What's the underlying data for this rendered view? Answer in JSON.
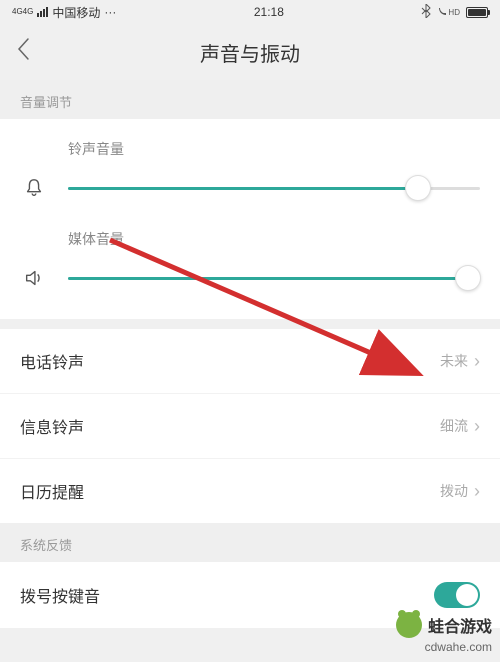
{
  "statusBar": {
    "carrier": "中国移动",
    "dots": "···",
    "time": "21:18",
    "hd": "HD",
    "batteryPercent": 90
  },
  "header": {
    "title": "声音与振动"
  },
  "sections": {
    "volume": "音量调节",
    "feedback": "系统反馈"
  },
  "sliders": {
    "ringtone": {
      "label": "铃声音量",
      "value": 85
    },
    "media": {
      "label": "媒体音量",
      "value": 97
    }
  },
  "items": {
    "phoneRingtone": {
      "label": "电话铃声",
      "value": "未来"
    },
    "messageRingtone": {
      "label": "信息铃声",
      "value": "细流"
    },
    "calendarAlert": {
      "label": "日历提醒",
      "value": "拨动"
    },
    "dialpad": {
      "label": "拨号按键音"
    }
  },
  "watermark": {
    "name": "蛙合游戏",
    "url": "cdwahe.com"
  }
}
